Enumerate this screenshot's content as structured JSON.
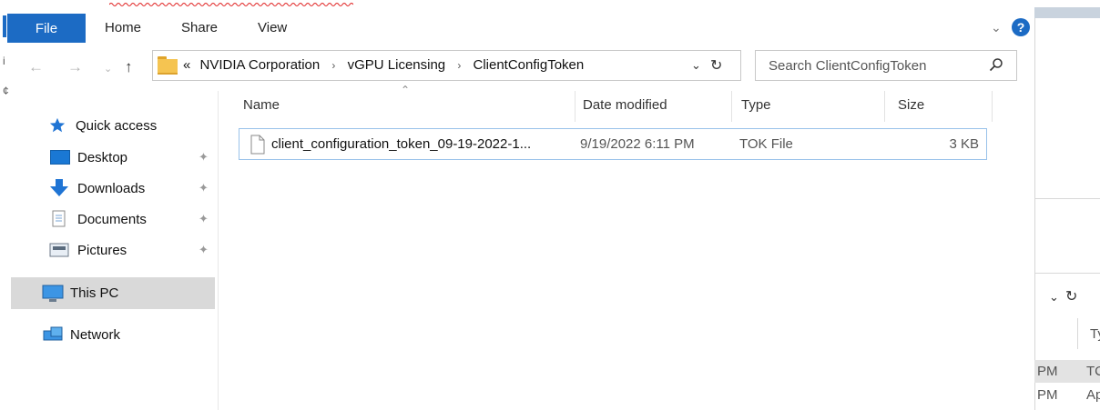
{
  "ribbon": {
    "tabs": [
      "File",
      "Home",
      "Share",
      "View"
    ],
    "chevron_icon": "chevron-down-icon",
    "help_icon": "help-icon",
    "accent_color": "#1c6bc4"
  },
  "address": {
    "overflow": "«",
    "crumbs": [
      "NVIDIA Corporation",
      "vGPU Licensing",
      "ClientConfigToken"
    ],
    "separator": "›"
  },
  "search": {
    "placeholder": "Search ClientConfigToken"
  },
  "nav": {
    "quick_access": "Quick access",
    "items": [
      {
        "label": "Desktop",
        "pinned": true
      },
      {
        "label": "Downloads",
        "pinned": true
      },
      {
        "label": "Documents",
        "pinned": true
      },
      {
        "label": "Pictures",
        "pinned": true
      }
    ],
    "this_pc": "This PC",
    "network": "Network"
  },
  "columns": {
    "name": "Name",
    "date": "Date modified",
    "type": "Type",
    "size": "Size"
  },
  "files": [
    {
      "name": "client_configuration_token_09-19-2022-1...",
      "date": "9/19/2022 6:11 PM",
      "type": "TOK File",
      "size": "3 KB"
    }
  ],
  "background_window": {
    "column_fragment": "Ty",
    "rows": [
      {
        "time": "PM",
        "type": "TC"
      },
      {
        "time": "PM",
        "type": "Ap"
      }
    ]
  }
}
